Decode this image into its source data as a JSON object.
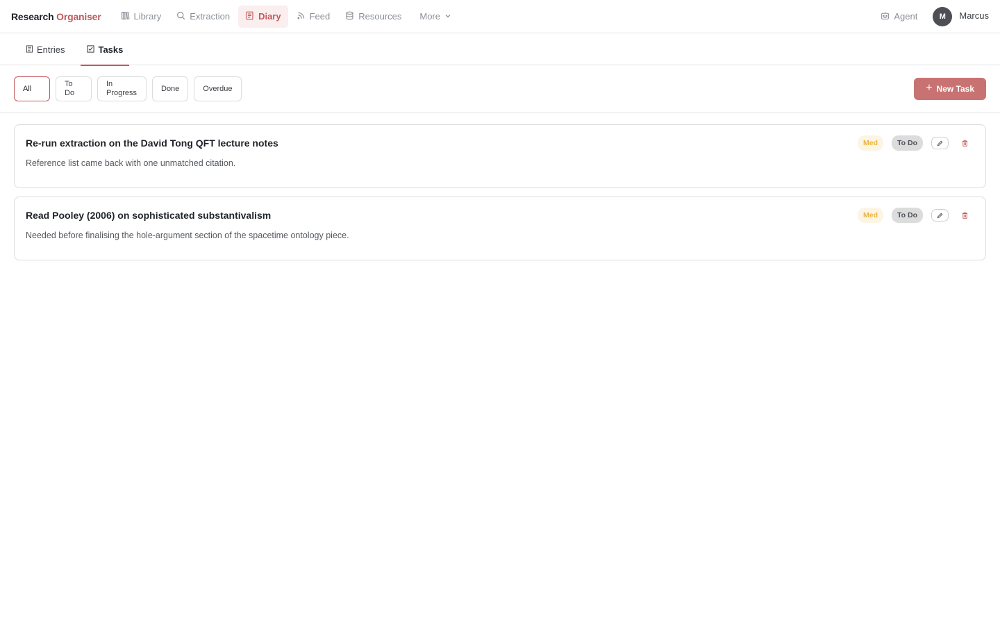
{
  "brand": {
    "part1": "Research",
    "part2": "Organiser"
  },
  "nav": {
    "items": [
      {
        "label": "Library",
        "icon": "library-icon"
      },
      {
        "label": "Extraction",
        "icon": "search-icon"
      },
      {
        "label": "Diary",
        "icon": "diary-icon"
      },
      {
        "label": "Feed",
        "icon": "rss-icon"
      },
      {
        "label": "Resources",
        "icon": "database-icon"
      }
    ],
    "active": "Diary",
    "more_label": "More"
  },
  "header_right": {
    "agent_label": "Agent",
    "user_initial": "M",
    "user_name": "Marcus"
  },
  "subtabs": [
    {
      "label": "Entries",
      "icon": "list-icon"
    },
    {
      "label": "Tasks",
      "icon": "checkbox-icon"
    }
  ],
  "active_subtab": "Tasks",
  "filters": {
    "items": [
      "All",
      "To Do",
      "In Progress",
      "Done",
      "Overdue"
    ],
    "selected": "All",
    "all": "All",
    "todo_line1": "To",
    "todo_line2": "Do",
    "inprogress_line1": "In",
    "inprogress_line2": "Progress",
    "done": "Done",
    "overdue": "Overdue"
  },
  "new_task_label": "New Task",
  "tasks": [
    {
      "title": "Re-run extraction on the David Tong QFT lecture notes",
      "description": "Reference list came back with one unmatched citation.",
      "priority": "Med",
      "status": "To Do"
    },
    {
      "title": "Read Pooley (2006) on sophisticated substantivalism",
      "description": "Needed before finalising the hole-argument section of the spacetime ontology piece.",
      "priority": "Med",
      "status": "To Do"
    }
  ],
  "colors": {
    "accent": "#c0595b",
    "button": "#c97272",
    "priority_med_bg": "#fdf5e4",
    "priority_med_text": "#e8b446",
    "status_bg": "#dcdcdc"
  }
}
